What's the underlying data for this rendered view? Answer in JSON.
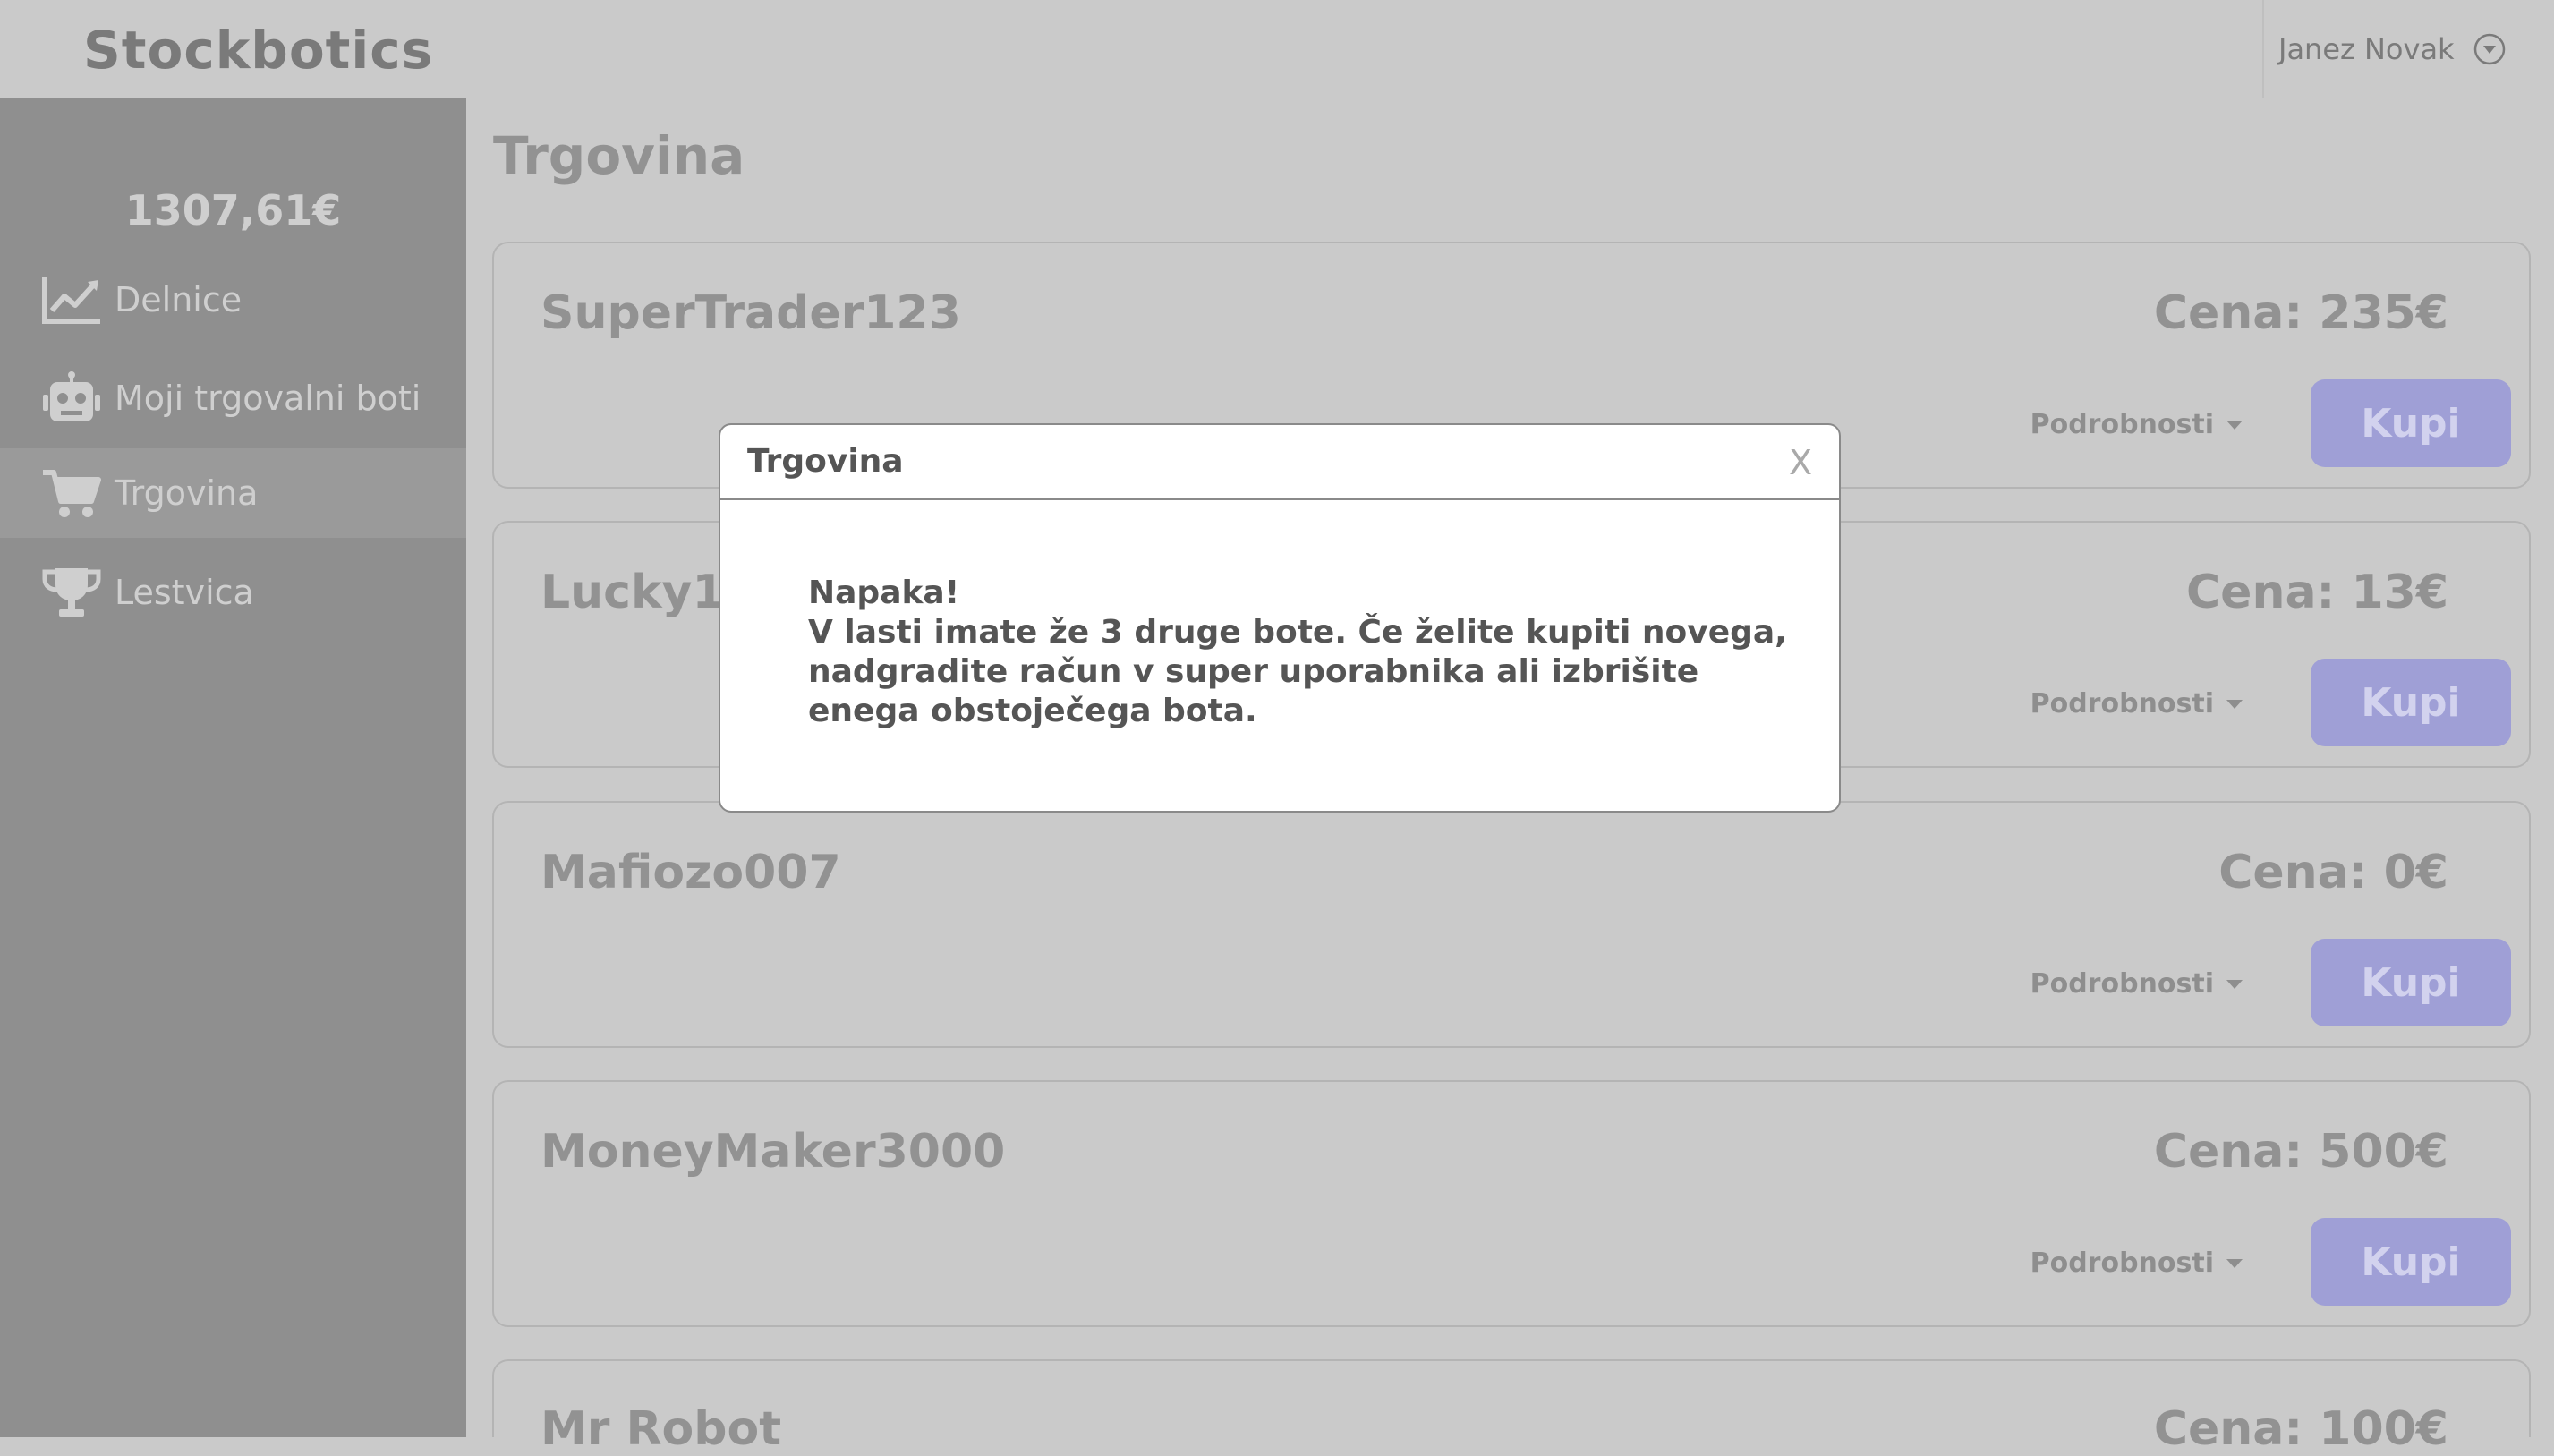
{
  "app": {
    "brand": "Stockbotics",
    "user_name": "Janez Novak"
  },
  "sidebar": {
    "balance": "1307,61€",
    "items": [
      {
        "label": "Delnice",
        "icon": "chart-icon"
      },
      {
        "label": "Moji trgovalni boti",
        "icon": "robot-icon"
      },
      {
        "label": "Trgovina",
        "icon": "cart-icon",
        "active": true
      },
      {
        "label": "Lestvica",
        "icon": "trophy-icon"
      }
    ]
  },
  "main": {
    "title": "Trgovina",
    "cards": [
      {
        "name": "SuperTrader123",
        "price": "Cena: 235€",
        "details": "Podrobnosti",
        "buy": "Kupi"
      },
      {
        "name": "Lucky13",
        "price": "Cena: 13€",
        "details": "Podrobnosti",
        "buy": "Kupi"
      },
      {
        "name": "Mafiozo007",
        "price": "Cena: 0€",
        "details": "Podrobnosti",
        "buy": "Kupi"
      },
      {
        "name": "MoneyMaker3000",
        "price": "Cena: 500€",
        "details": "Podrobnosti",
        "buy": "Kupi"
      },
      {
        "name": "Mr Robot",
        "price": "Cena: 100€"
      }
    ]
  },
  "modal": {
    "title": "Trgovina",
    "close": "X",
    "error_title": "Napaka!",
    "error_message": "V lasti imate že 3 druge bote. Če želite kupiti novega, nadgradite račun v super uporabnika ali izbrišite enega obstoječega bota."
  },
  "colors": {
    "background": "#cacaca",
    "sidebar": "#8f8f8f",
    "buy_button": "#9f9fd6",
    "modal_background": "#ffffff"
  }
}
